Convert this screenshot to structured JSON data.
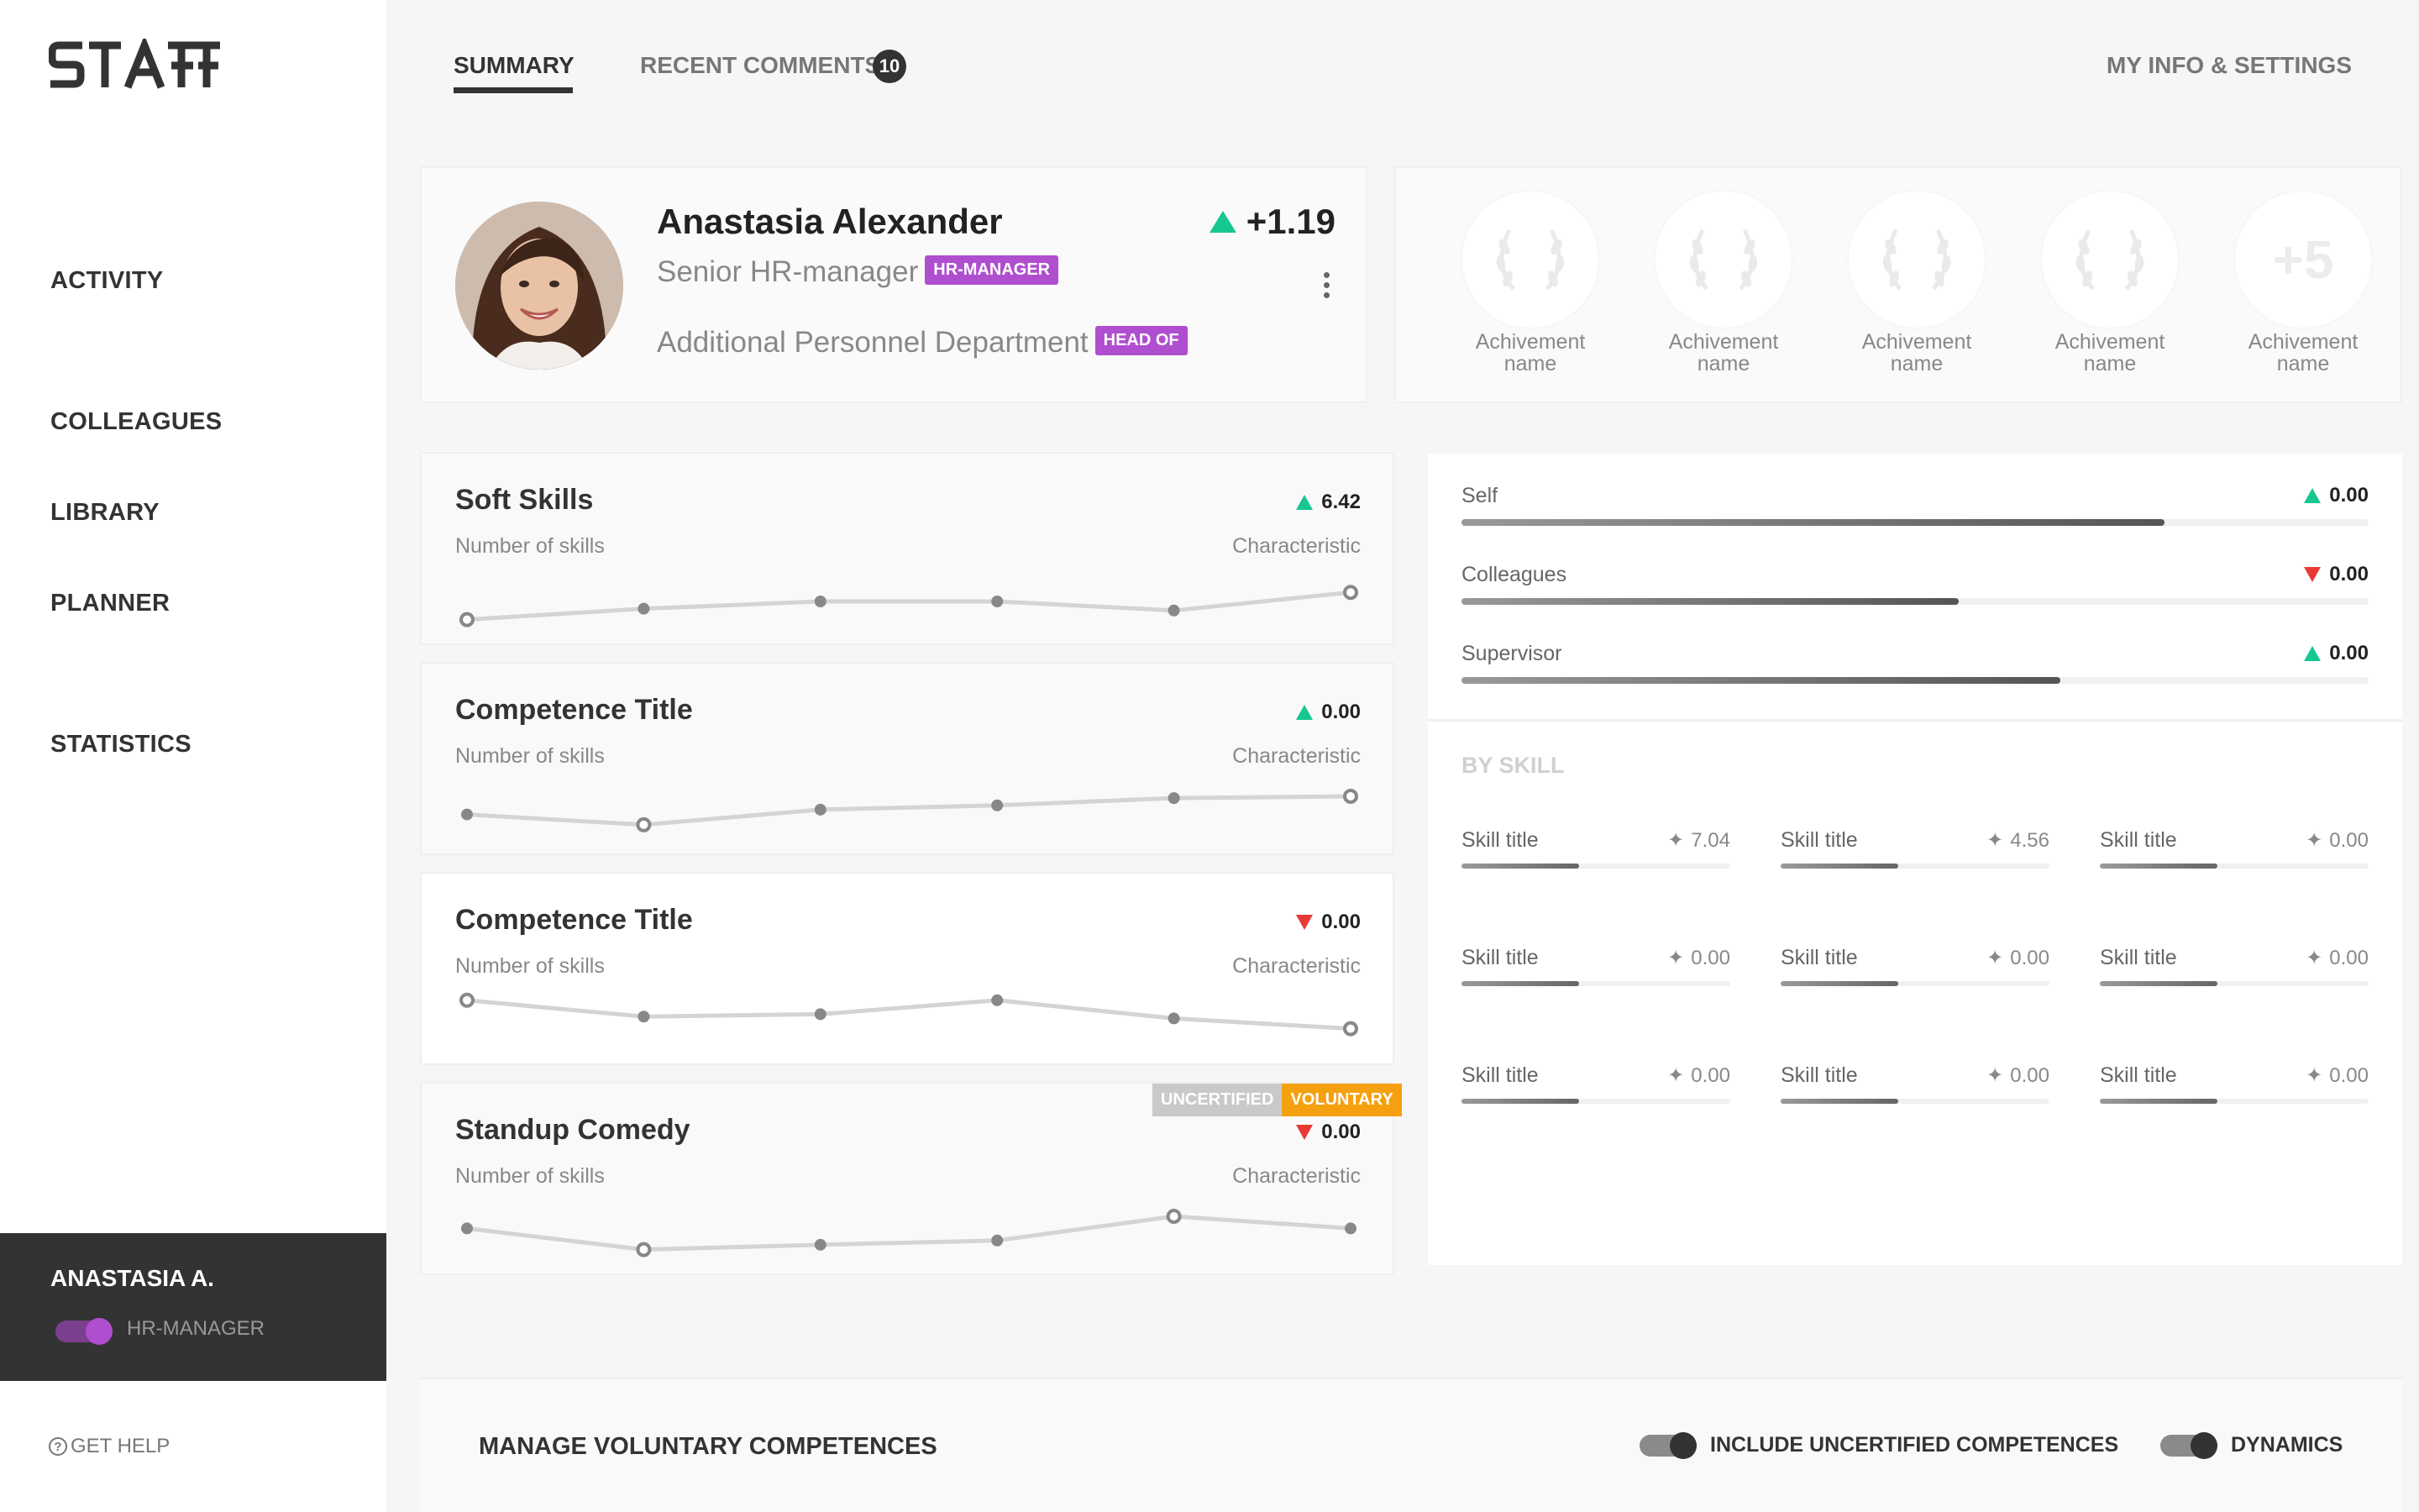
{
  "app": {
    "logo": "STAFF"
  },
  "nav": {
    "items": [
      {
        "label": "ACTIVITY"
      },
      {
        "label": "COLLEAGUES"
      },
      {
        "label": "LIBRARY"
      },
      {
        "label": "PLANNER"
      },
      {
        "label": "STATISTICS"
      }
    ]
  },
  "user": {
    "name": "ANASTASIA A.",
    "role": "HR-MANAGER"
  },
  "help": {
    "label": "GET HELP",
    "icon": "question-circle-icon"
  },
  "tabs": [
    {
      "label": "SUMMARY",
      "active": true
    },
    {
      "label": "RECENT COMMENTS",
      "count": "10"
    }
  ],
  "settings": {
    "label": "MY INFO & SETTINGS"
  },
  "profile": {
    "name": "Anastasia Alexander",
    "title": "Senior HR-manager",
    "title_tag": "HR-MANAGER",
    "department": "Additional Personnel Department",
    "department_tag": "HEAD OF",
    "delta": "+1.19",
    "delta_direction": "up"
  },
  "achievements": [
    {
      "label": "Achivement name",
      "icon": "laurel-wreath-icon"
    },
    {
      "label": "Achivement name",
      "icon": "laurel-wreath-icon"
    },
    {
      "label": "Achivement name",
      "icon": "laurel-wreath-icon"
    },
    {
      "label": "Achivement name",
      "icon": "laurel-wreath-icon"
    },
    {
      "label": "Achivement name",
      "more": "+5"
    }
  ],
  "competences": [
    {
      "title": "Soft Skills",
      "subtitle": "Number of skills",
      "characteristic": "Characteristic",
      "value": "6.42",
      "direction": "up",
      "trend": [
        0.2,
        0.38,
        0.5,
        0.5,
        0.35,
        0.65
      ],
      "hollow": [
        0,
        5
      ]
    },
    {
      "title": "Competence Title",
      "subtitle": "Number of skills",
      "characteristic": "Characteristic",
      "value": "0.00",
      "direction": "up",
      "trend": [
        0.45,
        0.28,
        0.53,
        0.6,
        0.72,
        0.75
      ],
      "hollow": [
        1,
        5
      ]
    },
    {
      "title": "Competence Title",
      "subtitle": "Number of skills",
      "characteristic": "Characteristic",
      "value": "0.00",
      "direction": "down",
      "trend": [
        0.85,
        0.58,
        0.62,
        0.85,
        0.55,
        0.38
      ],
      "hollow": [
        0,
        5
      ]
    },
    {
      "title": "Standup Comedy",
      "subtitle": "Number of skills",
      "characteristic": "Characteristic",
      "value": "0.00",
      "direction": "down",
      "trend": [
        0.55,
        0.2,
        0.28,
        0.35,
        0.75,
        0.55
      ],
      "hollow": [
        1,
        4
      ],
      "badges": [
        "UNCERTIFIED",
        "VOLUNTARY"
      ]
    }
  ],
  "ratings": [
    {
      "label": "Self",
      "value": "0.00",
      "direction": "up",
      "level": 0.775
    },
    {
      "label": "Colleagues",
      "value": "0.00",
      "direction": "down",
      "level": 0.548
    },
    {
      "label": "Supervisor",
      "value": "0.00",
      "direction": "up",
      "level": 0.66
    }
  ],
  "by_skill": {
    "heading": "BY SKILL",
    "skills": [
      {
        "label": "Skill title",
        "value": "7.04"
      },
      {
        "label": "Skill title",
        "value": "4.56"
      },
      {
        "label": "Skill title",
        "value": "0.00"
      },
      {
        "label": "Skill title",
        "value": "0.00"
      },
      {
        "label": "Skill title",
        "value": "0.00"
      },
      {
        "label": "Skill title",
        "value": "0.00"
      },
      {
        "label": "Skill title",
        "value": "0.00"
      },
      {
        "label": "Skill title",
        "value": "0.00"
      },
      {
        "label": "Skill title",
        "value": "0.00"
      }
    ]
  },
  "footer": {
    "manage": "MANAGE VOLUNTARY COMPETENCES",
    "include_uncertified": "INCLUDE UNCERTIFIED COMPETENCES",
    "dynamics": "DYNAMICS"
  },
  "colors": {
    "accent": "#b04ed0",
    "up": "#17c792",
    "down": "#e83a35",
    "voluntary": "#f5a00f",
    "uncertified": "#c9c9c9",
    "dark": "#333333"
  }
}
